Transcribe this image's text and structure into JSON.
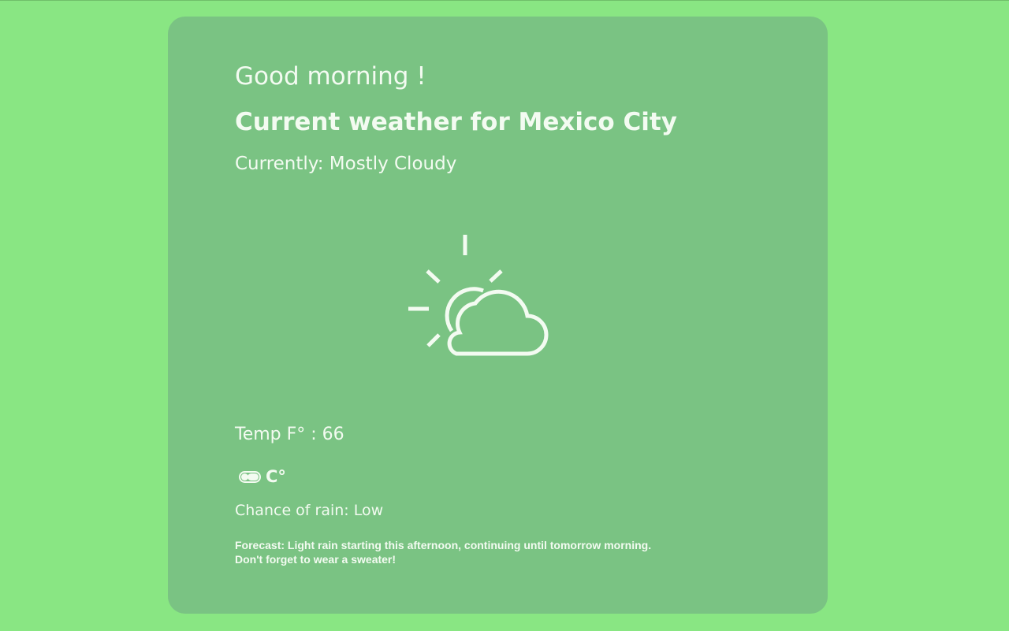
{
  "page": {
    "background_color": "#89e683",
    "card_color": "#7ac383",
    "text_color": "#f3fbf1"
  },
  "weather": {
    "greeting": "Good morning !",
    "location_title": "Current weather for Mexico City",
    "condition": "Currently: Mostly Cloudy",
    "icon": "partly-cloudy-icon",
    "temperature": "Temp F° : 66",
    "unit_toggle_label": "C°",
    "rain_chance": "Chance of rain: Low",
    "forecast_line1": "Forecast: Light rain starting this afternoon, continuing until tomorrow morning.",
    "forecast_line2": "Don't forget to wear a sweater!"
  }
}
